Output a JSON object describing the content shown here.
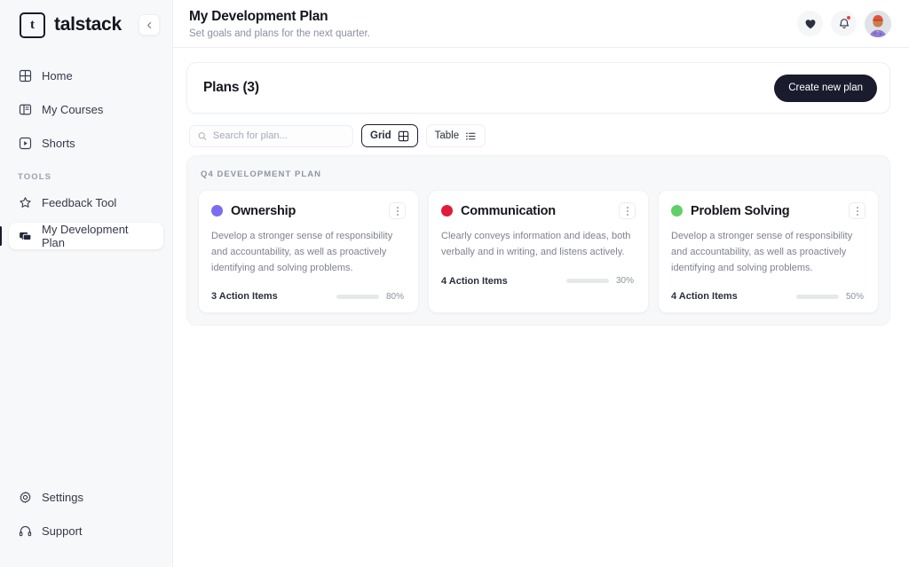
{
  "colors": {
    "accent_dark": "#1b1b2e",
    "progress_fill": "#f5b183",
    "notification": "#ef3e4a"
  },
  "sidebar": {
    "brand": {
      "logo_glyph": "t",
      "name": "talstack"
    },
    "collapse_icon": "chevron-left-icon",
    "items": [
      {
        "label": "Home",
        "icon": "grid-icon",
        "active": false
      },
      {
        "label": "My Courses",
        "icon": "columns-icon",
        "active": false
      },
      {
        "label": "Shorts",
        "icon": "play-square-icon",
        "active": false
      }
    ],
    "tools_label": "TOOLS",
    "tools": [
      {
        "label": "Feedback Tool",
        "icon": "star-icon",
        "active": false
      },
      {
        "label": "My Development Plan",
        "icon": "chat-bubbles-icon",
        "active": true
      }
    ],
    "bottom": [
      {
        "label": "Settings",
        "icon": "gear-icon"
      },
      {
        "label": "Support",
        "icon": "headphones-icon"
      }
    ]
  },
  "topbar": {
    "title": "My Development Plan",
    "subtitle": "Set goals and plans for the next quarter.",
    "favorites_icon": "heart-icon",
    "notifications_icon": "bell-icon",
    "avatar_label": "user-avatar"
  },
  "plans_header": {
    "title": "Plans (3)",
    "create_button": "Create new plan"
  },
  "toolbar": {
    "search_placeholder": "Search for plan...",
    "search_value": "",
    "search_icon": "search-icon",
    "grid_label": "Grid",
    "grid_icon": "grid-view-icon",
    "table_label": "Table",
    "table_icon": "list-view-icon"
  },
  "group": {
    "label": "Q4 DEVELOPMENT PLAN",
    "cards": [
      {
        "dot_color": "#7b6cf0",
        "title": "Ownership",
        "description": "Develop a stronger sense of responsibility and accountability, as well as proactively identifying and solving problems.",
        "action_items": "3 Action Items",
        "progress": 80,
        "progress_label": "80%"
      },
      {
        "dot_color": "#e01b3c",
        "title": "Communication",
        "description": "Clearly conveys information and ideas, both verbally and in writing, and listens actively.",
        "action_items": "4 Action Items",
        "progress": 30,
        "progress_label": "30%"
      },
      {
        "dot_color": "#60d06a",
        "title": "Problem Solving",
        "description": "Develop a stronger sense of responsibility and accountability, as well as proactively identifying and solving problems.",
        "action_items": "4 Action Items",
        "progress": 50,
        "progress_label": "50%"
      }
    ]
  }
}
